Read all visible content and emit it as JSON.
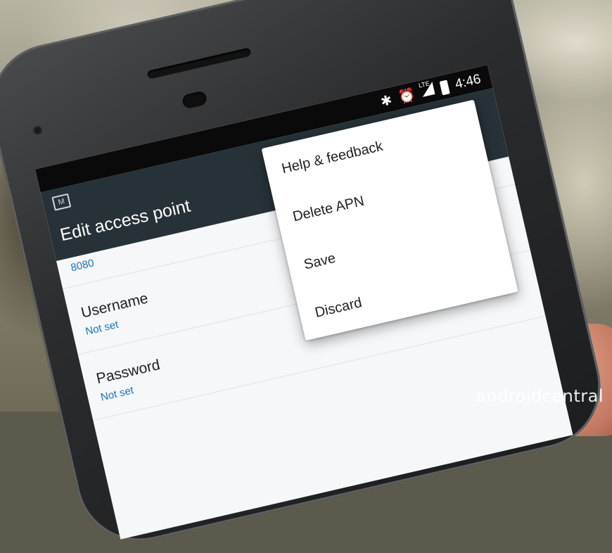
{
  "status_bar": {
    "time": "4:46",
    "icons": [
      "bluetooth-icon",
      "alarm-icon",
      "lte-signal-icon",
      "battery-icon"
    ],
    "lte_label": "LTE"
  },
  "toolbar": {
    "title": "Edit access point",
    "app_icon": "mail-icon"
  },
  "list": {
    "port_value": "8080",
    "items": [
      {
        "title": "Username",
        "value": "Not set"
      },
      {
        "title": "Password",
        "value": "Not set"
      }
    ]
  },
  "menu": {
    "items": [
      "Help & feedback",
      "Delete APN",
      "Save",
      "Discard"
    ]
  },
  "watermark": "androidcentral",
  "colors": {
    "toolbar": "#263238",
    "accent": "#1a73b8",
    "screen_bg": "#f5f7f9"
  }
}
